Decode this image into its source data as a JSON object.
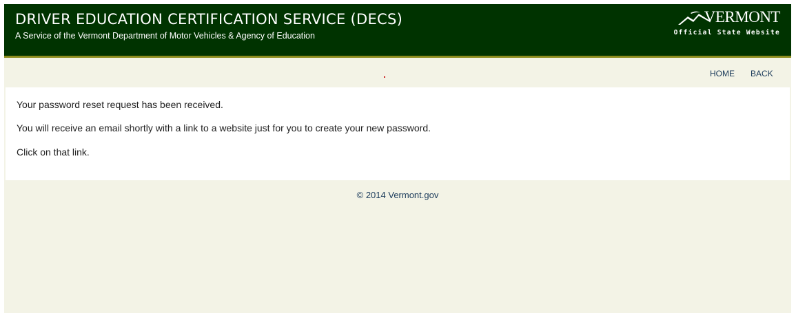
{
  "banner": {
    "title": "DRIVER EDUCATION CERTIFICATION SERVICE (DECS)",
    "subtitle": "A Service of the Vermont Department of Motor Vehicles & Agency of Education"
  },
  "vt_logo": {
    "wordmark": "VERMONT",
    "tagline": "Official State Website",
    "icon": "vermont-mountain-icon"
  },
  "nav": {
    "home_label": "HOME",
    "back_label": "BACK"
  },
  "message": {
    "line1": "Your password reset request has been received.",
    "line2": "You will receive an email shortly with a link to a website just for you to create your new password.",
    "line3": "Click on that link."
  },
  "footer": {
    "copyright": "© 2014 Vermont.gov"
  },
  "colors": {
    "banner_bg": "#003300",
    "banner_rule": "#8c8c1e",
    "page_bg": "#f3f3e6",
    "link": "#1a3a5a"
  }
}
